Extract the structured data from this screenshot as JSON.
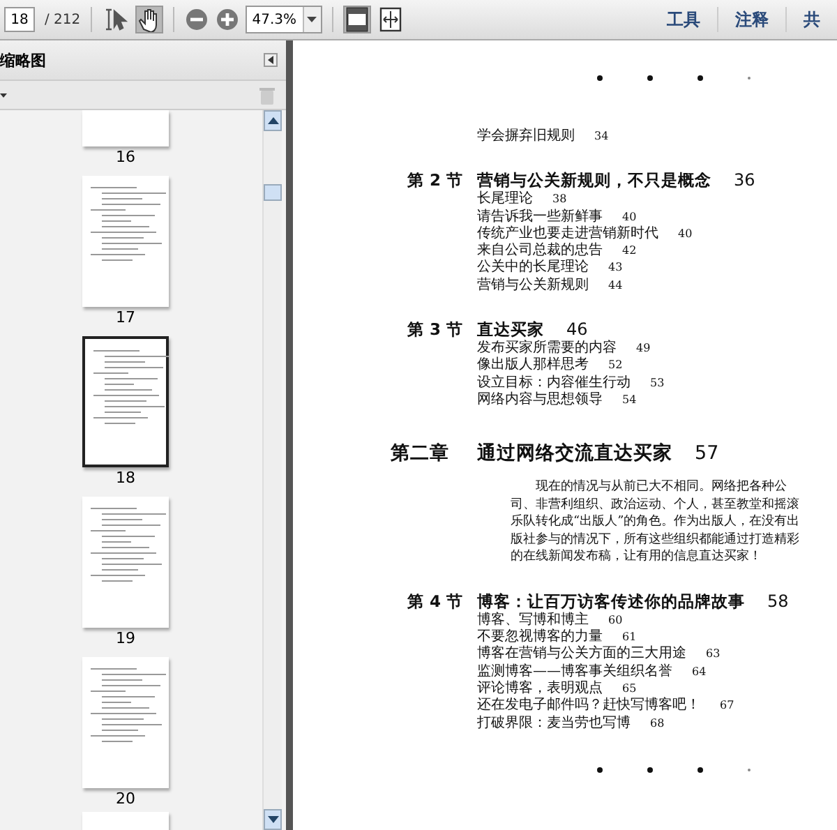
{
  "toolbar": {
    "page_field": "18",
    "page_count": "/ 212",
    "tools": [
      {
        "kind": "select",
        "selected": false
      },
      {
        "kind": "hand",
        "selected": true
      }
    ],
    "zoom_field": "47.3%",
    "views": [
      {
        "kind": "fit-page",
        "selected": true
      },
      {
        "kind": "fit-width",
        "selected": false
      }
    ],
    "menu": [
      "工具",
      "注释",
      "共"
    ]
  },
  "sidebar": {
    "title": "缩略图",
    "thumbnails": [
      {
        "label": "16",
        "selected": false
      },
      {
        "label": "17",
        "selected": false
      },
      {
        "label": "18",
        "selected": true
      },
      {
        "label": "19",
        "selected": false
      },
      {
        "label": "20",
        "selected": false
      }
    ]
  },
  "page": {
    "toc": [
      {
        "kind": "entry",
        "text": "学会摒弃旧规则",
        "page": "34"
      },
      {
        "kind": "section",
        "label": "第 2 节",
        "title": "营销与公关新规则，不只是概念",
        "page": "36",
        "entries": [
          {
            "text": "长尾理论",
            "page": "38"
          },
          {
            "text": "请告诉我一些新鲜事",
            "page": "40"
          },
          {
            "text": "传统产业也要走进营销新时代",
            "page": "40"
          },
          {
            "text": "来自公司总裁的忠告",
            "page": "42"
          },
          {
            "text": "公关中的长尾理论",
            "page": "43"
          },
          {
            "text": "营销与公关新规则",
            "page": "44"
          }
        ]
      },
      {
        "kind": "section",
        "label": "第 3 节",
        "title": "直达买家",
        "page": "46",
        "entries": [
          {
            "text": "发布买家所需要的内容",
            "page": "49"
          },
          {
            "text": "像出版人那样思考",
            "page": "52"
          },
          {
            "text": "设立目标：内容催生行动",
            "page": "53"
          },
          {
            "text": "网络内容与思想领导",
            "page": "54"
          }
        ]
      },
      {
        "kind": "chapter",
        "label": "第二章",
        "title": "通过网络交流直达买家",
        "page": "57",
        "intro": "现在的情况与从前已大不相同。网络把各种公司、非营利组织、政治运动、个人，甚至教堂和摇滚乐队转化成“出版人”的角色。作为出版人，在没有出版社参与的情况下，所有这些组织都能通过打造精彩的在线新闻发布稿，让有用的信息直达买家！"
      },
      {
        "kind": "section",
        "label": "第 4 节",
        "title": "博客：让百万访客传述你的品牌故事",
        "page": "58",
        "entries": [
          {
            "text": "博客、写博和博主",
            "page": "60"
          },
          {
            "text": "不要忽视博客的力量",
            "page": "61"
          },
          {
            "text": "博客在营销与公关方面的三大用途",
            "page": "63"
          },
          {
            "text": "监测博客——博客事关组织名誉",
            "page": "64"
          },
          {
            "text": "评论博客，表明观点",
            "page": "65"
          },
          {
            "text": "还在发电子邮件吗？赶快写博客吧！",
            "page": "67"
          },
          {
            "text": "打破界限：麦当劳也写博",
            "page": "68"
          }
        ]
      }
    ]
  }
}
